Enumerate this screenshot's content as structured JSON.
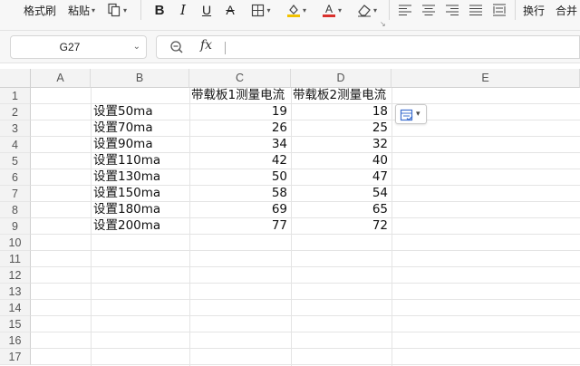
{
  "toolbar": {
    "format_painter": "格式刷",
    "paste": "粘贴",
    "wrap": "换行",
    "merge": "合并"
  },
  "formula_bar": {
    "name_box": "G27",
    "fx": "fx",
    "formula": ""
  },
  "columns": [
    "A",
    "B",
    "C",
    "D",
    "E"
  ],
  "rows": [
    "1",
    "2",
    "3",
    "4",
    "5",
    "6",
    "7",
    "8",
    "9",
    "10",
    "11",
    "12",
    "13",
    "14",
    "15",
    "16",
    "17"
  ],
  "sheet": {
    "header": {
      "c": "带载板1测量电流",
      "d": "带载板2测量电流"
    },
    "data": [
      {
        "b": "设置50ma",
        "c": "19",
        "d": "18"
      },
      {
        "b": "设置70ma",
        "c": "26",
        "d": "25"
      },
      {
        "b": "设置90ma",
        "c": "34",
        "d": "32"
      },
      {
        "b": "设置110ma",
        "c": "42",
        "d": "40"
      },
      {
        "b": "设置130ma",
        "c": "50",
        "d": "47"
      },
      {
        "b": "设置150ma",
        "c": "58",
        "d": "54"
      },
      {
        "b": "设置180ma",
        "c": "69",
        "d": "65"
      },
      {
        "b": "设置200ma",
        "c": "77",
        "d": "72"
      }
    ]
  },
  "colors": {
    "highlight": "#f2c200",
    "font_color": "#d9302c",
    "paste_icon": "#3d6fcf"
  }
}
